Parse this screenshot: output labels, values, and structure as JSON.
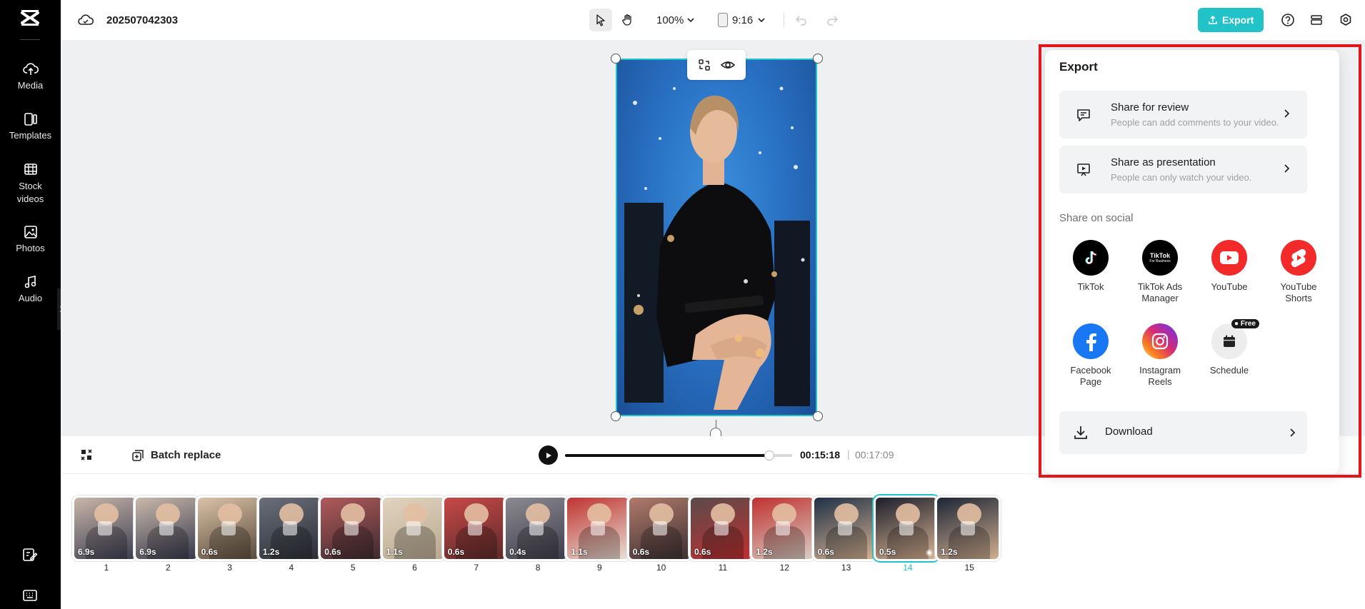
{
  "app": {
    "project_title": "202507042303"
  },
  "sidebar": {
    "items": [
      {
        "label": "Media",
        "icon": "cloud-upload-icon"
      },
      {
        "label": "Templates",
        "icon": "templates-icon"
      },
      {
        "label": "Stock videos",
        "icon": "film-icon"
      },
      {
        "label": "Photos",
        "icon": "image-icon"
      },
      {
        "label": "Audio",
        "icon": "music-note-icon"
      }
    ]
  },
  "toolbar": {
    "zoom": "100%",
    "ratio": "9:16",
    "export_label": "Export",
    "accent_color": "#21c3c8"
  },
  "player": {
    "batch_replace_label": "Batch replace",
    "current_time": "00:15:18",
    "separator": "|",
    "total_time": "00:17:09",
    "progress": 0.899
  },
  "clips": [
    {
      "num": "1",
      "dur": "6.9s"
    },
    {
      "num": "2",
      "dur": "6.9s"
    },
    {
      "num": "3",
      "dur": "0.6s"
    },
    {
      "num": "4",
      "dur": "1.2s"
    },
    {
      "num": "5",
      "dur": "0.6s"
    },
    {
      "num": "6",
      "dur": "1.1s"
    },
    {
      "num": "7",
      "dur": "0.6s"
    },
    {
      "num": "8",
      "dur": "0.4s"
    },
    {
      "num": "9",
      "dur": "1.1s"
    },
    {
      "num": "10",
      "dur": "0.6s"
    },
    {
      "num": "11",
      "dur": "0.6s"
    },
    {
      "num": "12",
      "dur": "1.2s"
    },
    {
      "num": "13",
      "dur": "0.6s"
    },
    {
      "num": "14",
      "dur": "0.5s"
    },
    {
      "num": "15",
      "dur": "1.2s"
    }
  ],
  "export_panel": {
    "title": "Export",
    "share_review": {
      "title": "Share for review",
      "subtitle": "People can add comments to your video."
    },
    "share_presentation": {
      "title": "Share as presentation",
      "subtitle": "People can only watch your video."
    },
    "social_label": "Share on social",
    "social": {
      "tiktok": "TikTok",
      "tiktok_ads_1": "TikTok Ads",
      "tiktok_ads_2": "Manager",
      "tiktok_ads_logo_1": "TikTok",
      "tiktok_ads_logo_2": "For Business",
      "youtube": "YouTube",
      "shorts_1": "YouTube",
      "shorts_2": "Shorts",
      "facebook_1": "Facebook",
      "facebook_2": "Page",
      "instagram_1": "Instagram",
      "instagram_2": "Reels",
      "schedule": "Schedule",
      "free_badge": "Free"
    },
    "download_label": "Download"
  }
}
